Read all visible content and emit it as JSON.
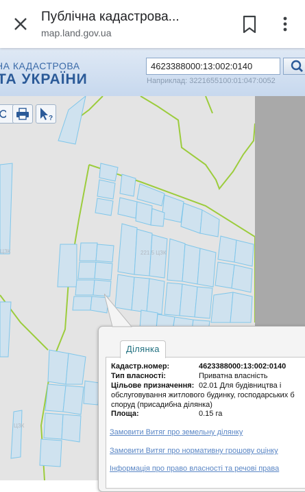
{
  "browser": {
    "title": "Публічна кадастрова...",
    "url": "map.land.gov.ua"
  },
  "header": {
    "line1": "НА КАДАСТРОВА",
    "line2": "ТА УКРАЇНИ"
  },
  "search": {
    "value": "4623388000:13:002:0140",
    "hint": "Наприклад: 3221655100:01:047:0052"
  },
  "map": {
    "labels": [
      "221.5 ЦЗК",
      "ЦЗК",
      "ЦЗК"
    ]
  },
  "popup": {
    "tab": "Ділянка",
    "fields": [
      {
        "label": "Кадастр.номер:",
        "value": "4623388000:13:002:0140"
      },
      {
        "label": "Тип власності:",
        "value": "Приватна власність"
      },
      {
        "label": "Цільове призначення:",
        "value": "02.01 Для будівництва і"
      },
      {
        "label": "",
        "value": "обслуговування житлового будинку, господарських б"
      },
      {
        "label": "",
        "value": "споруд (присадибна ділянка)"
      },
      {
        "label": "Площа:",
        "value": "0.15 га"
      }
    ],
    "links": [
      "Замовити Витяг про земельну ділянку",
      "Замовити Витяг про нормативну грошову оцінку",
      "Інформація про право власності та речові права"
    ]
  },
  "colors": {
    "parcel_fill": "#cfe2ef",
    "parcel_stroke": "#7fc6ea",
    "boundary": "#9ccc3c",
    "link": "#5a86c5"
  },
  "icons": {
    "close": "close-icon",
    "bookmark": "bookmark-icon",
    "menu": "more-vert-icon",
    "search": "search-icon",
    "print": "printer-icon",
    "identify": "cursor-help-icon"
  }
}
